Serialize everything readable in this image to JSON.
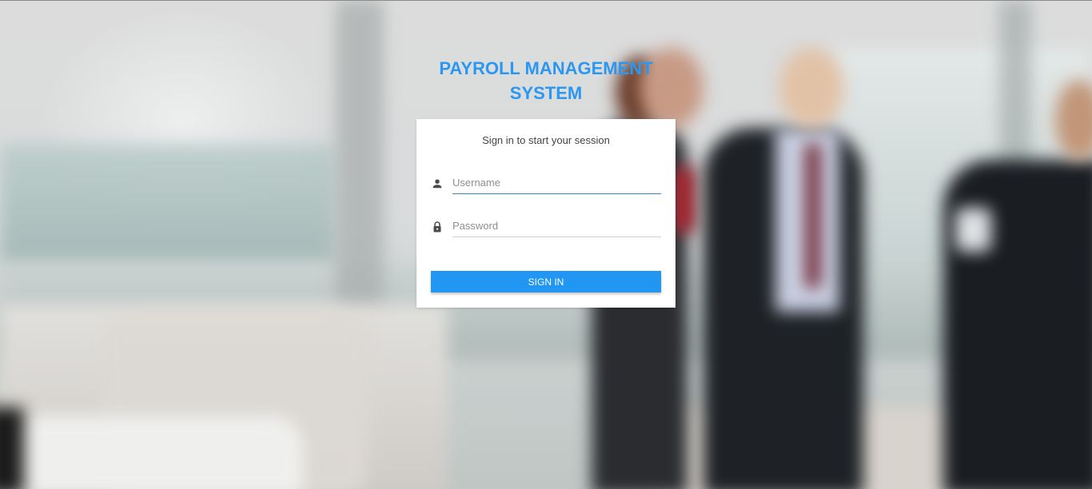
{
  "header": {
    "title_line1": "PAYROLL MANAGEMENT",
    "title_line2": "SYSTEM"
  },
  "login_card": {
    "subtitle": "Sign in to start your session",
    "username": {
      "placeholder": "Username",
      "value": "",
      "icon": "person-icon"
    },
    "password": {
      "placeholder": "Password",
      "value": "",
      "icon": "lock-icon"
    },
    "signin_label": "SIGN IN"
  },
  "colors": {
    "accent": "#2196f3",
    "title": "#2a97f2",
    "card_background": "#ffffff",
    "active_underline": "#3a86c9"
  }
}
